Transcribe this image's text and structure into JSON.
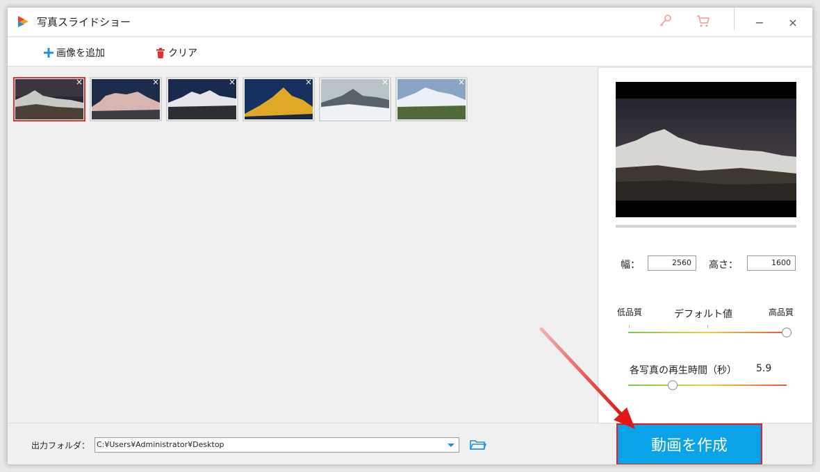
{
  "window": {
    "title": "写真スライドショー"
  },
  "icons": {
    "app": "app-logo-icon",
    "key": "key-icon",
    "cart": "cart-icon",
    "minimize": "minimize-icon",
    "close": "close-icon",
    "plus": "plus-icon",
    "trash": "trash-icon",
    "remove": "remove-image-icon",
    "dropdown": "chevron-down-icon",
    "folder": "folder-icon"
  },
  "titlebar": {
    "minimize_glyph": "−",
    "close_glyph": "×"
  },
  "toolbar": {
    "add_label": "画像を追加",
    "clear_label": "クリア"
  },
  "thumbnails": [
    {
      "remove_glyph": "×",
      "selected": true
    },
    {
      "remove_glyph": "×",
      "selected": false
    },
    {
      "remove_glyph": "×",
      "selected": false
    },
    {
      "remove_glyph": "×",
      "selected": false
    },
    {
      "remove_glyph": "×",
      "selected": false
    },
    {
      "remove_glyph": "×",
      "selected": false
    }
  ],
  "settings": {
    "width_label": "幅：",
    "width_value": "2560",
    "height_label": "高さ：",
    "height_value": "1600",
    "quality_low": "低品質",
    "quality_default": "デフォルト値",
    "quality_high": "高品質",
    "quality_level": 1.0,
    "duration_label": "各写真の再生時間（秒）",
    "duration_value": "5.9",
    "duration_level": 0.28
  },
  "output": {
    "folder_label": "出力フォルダ：",
    "folder_path": "C:¥Users¥Administrator¥Desktop"
  },
  "actions": {
    "create_label": "動画を作成"
  },
  "colors": {
    "accent": "#0aa2e8",
    "highlight": "#e02020",
    "add_icon": "#1e8fe0",
    "trash_icon": "#e03030"
  }
}
